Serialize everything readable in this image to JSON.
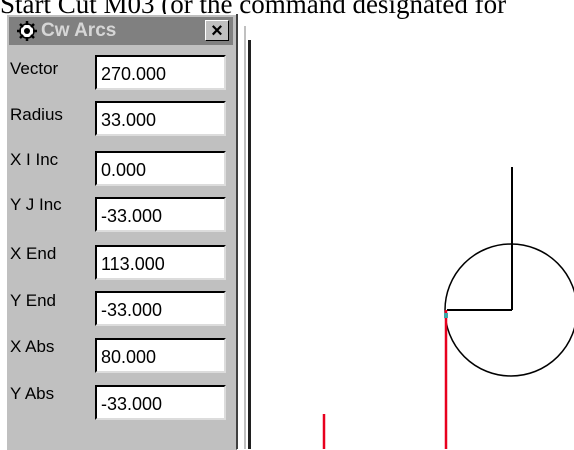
{
  "document": {
    "text": "Start Cut M03 (or the command designated for"
  },
  "palette": {
    "title": "Cw Arcs",
    "close_glyph": "×",
    "icon": "gear-icon",
    "fields": [
      {
        "label": "Vector",
        "value": "270.000"
      },
      {
        "label": "Radius",
        "value": "33.000"
      },
      {
        "label": "X I Inc",
        "value": "0.000"
      },
      {
        "label": "Y J Inc",
        "value": "-33.000"
      },
      {
        "label": "X End",
        "value": "113.000"
      },
      {
        "label": "Y End",
        "value": "-33.000"
      },
      {
        "label": "X Abs",
        "value": "80.000"
      },
      {
        "label": "Y Abs",
        "value": "-33.000"
      }
    ]
  },
  "colors": {
    "toolpath": "#e8001e",
    "geometry": "#000000",
    "titlebar": "#808080"
  }
}
